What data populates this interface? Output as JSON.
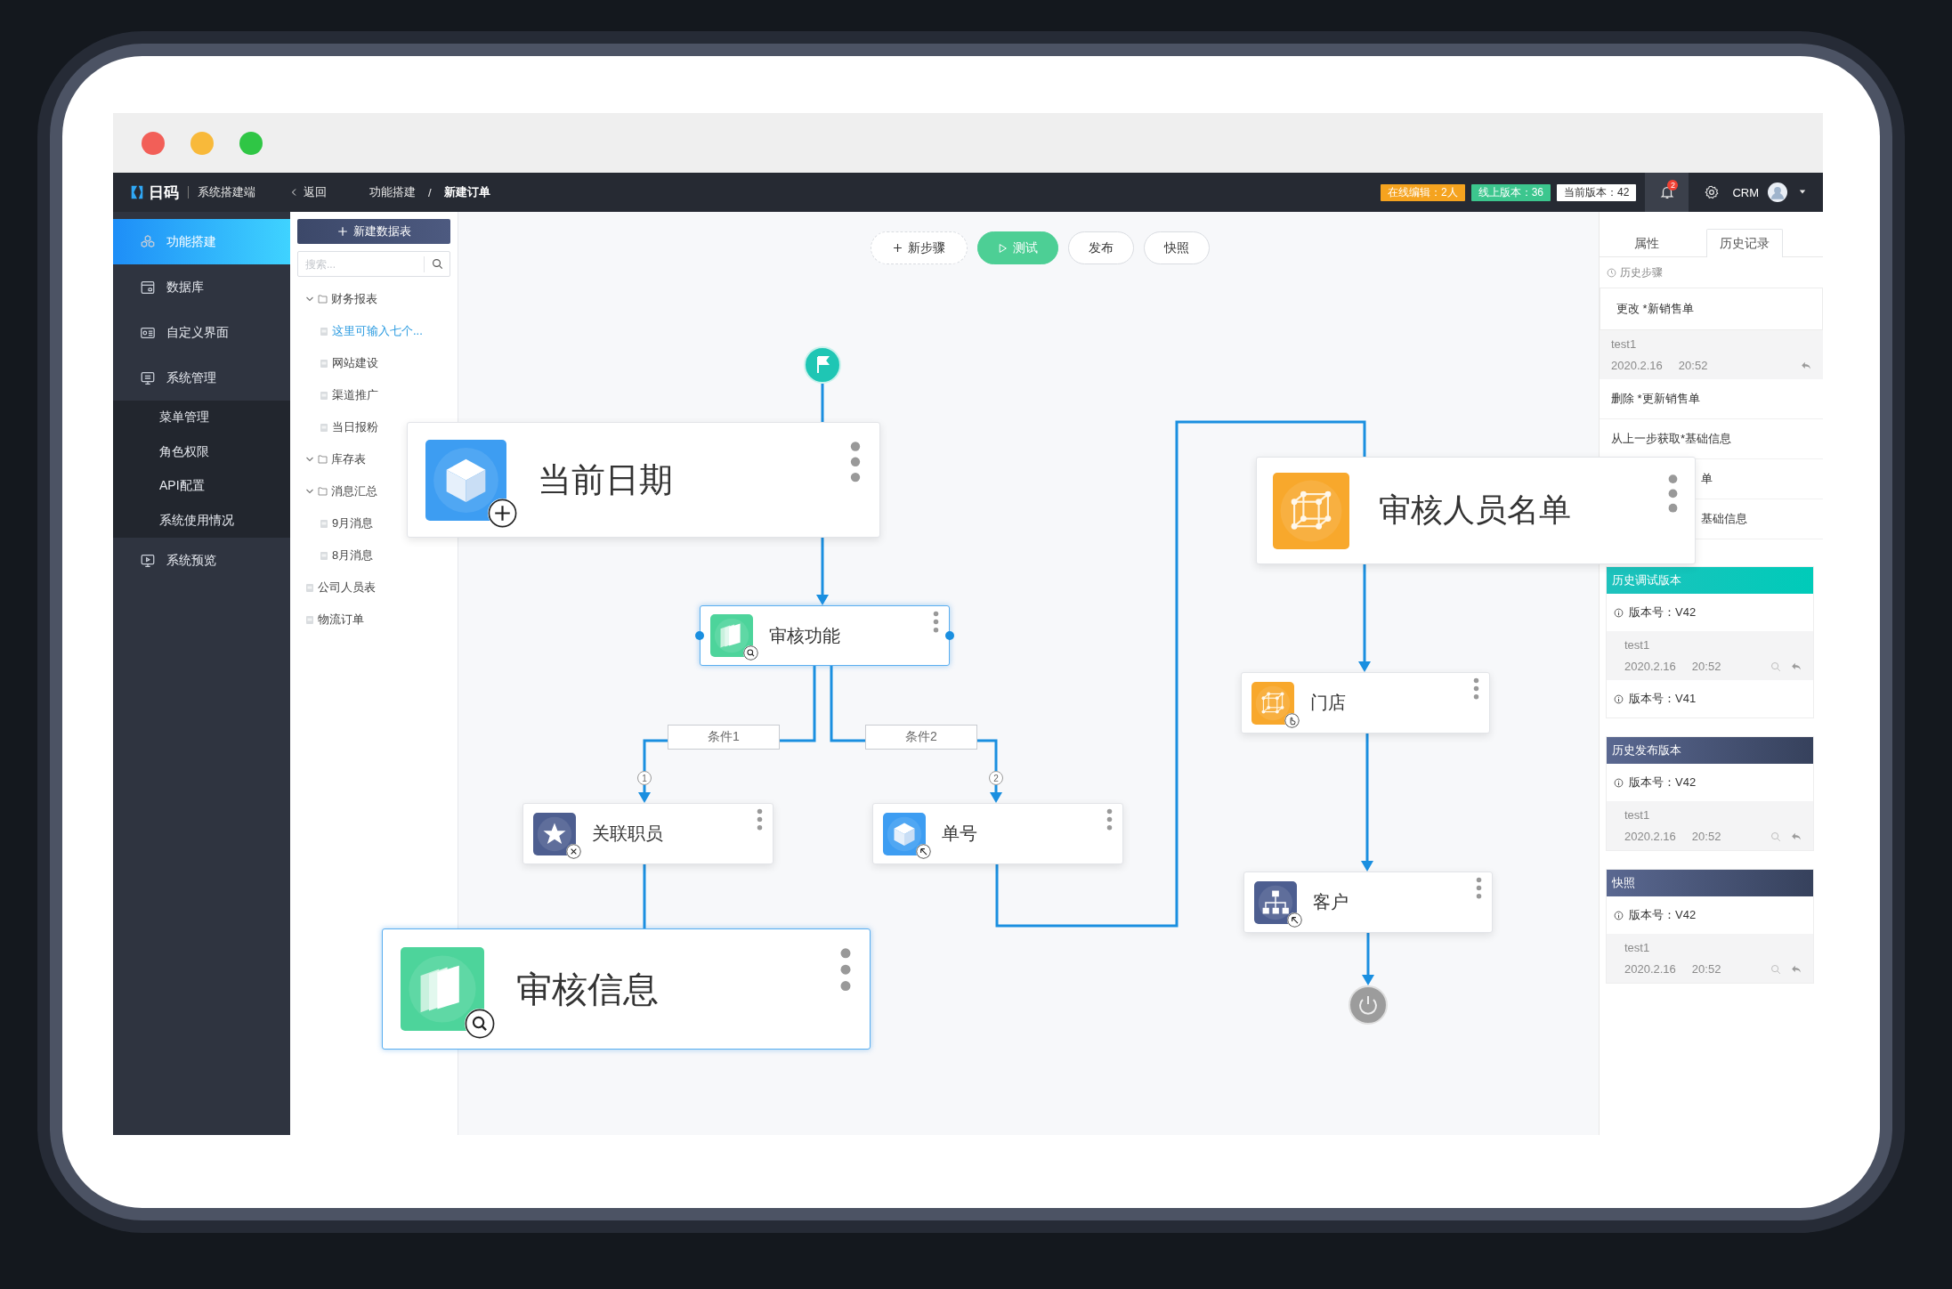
{
  "topbar": {
    "logo": "日码",
    "app_name": "系统搭建端",
    "back": "返回",
    "breadcrumb": [
      {
        "label": "功能搭建",
        "current": false
      },
      {
        "label": "新建订单",
        "current": true
      }
    ],
    "separator": "/",
    "badges": [
      {
        "text": "在线编辑：2人",
        "color": "#f5a31f"
      },
      {
        "text": "线上版本：36",
        "color": "#3cc68e"
      },
      {
        "text": "当前版本：42",
        "color": "#ffffff"
      }
    ],
    "notifications": "2",
    "user": "CRM"
  },
  "sidebar": {
    "items": [
      {
        "label": "功能搭建",
        "selected": true
      },
      {
        "label": "数据库",
        "selected": false
      },
      {
        "label": "自定义界面",
        "selected": false
      },
      {
        "label": "系统管理",
        "selected": false,
        "children": [
          {
            "label": "菜单管理",
            "selected": false
          },
          {
            "label": "角色权限",
            "selected": false
          },
          {
            "label": "API配置",
            "selected": false
          },
          {
            "label": "系统使用情况",
            "selected": false
          }
        ]
      },
      {
        "label": "系统预览",
        "selected": false
      }
    ]
  },
  "tree": {
    "new_button": "新建数据表",
    "search": {
      "placeholder": "搜索..."
    },
    "items": [
      {
        "label": "财务报表",
        "kind": "folder",
        "expanded": true,
        "selected": false,
        "children": [
          {
            "label": "这里可输入七个...",
            "kind": "file",
            "selected": true
          },
          {
            "label": "网站建设",
            "kind": "file",
            "selected": false
          },
          {
            "label": "渠道推广",
            "kind": "file",
            "selected": false
          },
          {
            "label": "当日报粉",
            "kind": "file",
            "selected": false
          }
        ]
      },
      {
        "label": "库存表",
        "kind": "folder",
        "expanded": true,
        "selected": false
      },
      {
        "label": "消息汇总",
        "kind": "folder",
        "expanded": true,
        "selected": false,
        "children": [
          {
            "label": "9月消息",
            "kind": "file",
            "selected": false
          },
          {
            "label": "8月消息",
            "kind": "file",
            "selected": false
          }
        ]
      },
      {
        "label": "公司人员表",
        "kind": "file",
        "selected": false
      },
      {
        "label": "物流订单",
        "kind": "file",
        "selected": false
      }
    ]
  },
  "canvas": {
    "toolbar": [
      {
        "label": "新步骤",
        "kind": "add"
      },
      {
        "label": "测试",
        "kind": "run"
      },
      {
        "label": "发布",
        "kind": "plain"
      },
      {
        "label": "快照",
        "kind": "plain"
      }
    ],
    "nodes": [
      {
        "title": "当前日期",
        "color": "#3d9df2",
        "highlighted": false
      },
      {
        "title": "审核功能",
        "color": "#4dd49b",
        "highlighted": true
      },
      {
        "title": "关联职员",
        "color": "#4d5e90",
        "highlighted": false
      },
      {
        "title": "单号",
        "color": "#3d9df2",
        "highlighted": false
      },
      {
        "title": "审核信息",
        "color": "#4dd49b",
        "highlighted": true
      },
      {
        "title": "审核人员名单",
        "color": "#f8a82c",
        "highlighted": false
      },
      {
        "title": "门店",
        "color": "#f8a82c",
        "highlighted": false
      },
      {
        "title": "客户",
        "color": "#4d5e90",
        "highlighted": false
      }
    ],
    "branches": [
      {
        "label": "条件1",
        "number": "1"
      },
      {
        "label": "条件2",
        "number": "2"
      }
    ]
  },
  "panel": {
    "tabs": [
      {
        "label": "属性",
        "selected": false
      },
      {
        "label": "历史记录",
        "selected": true
      }
    ],
    "steps_title": "历史步骤",
    "steps": [
      {
        "kind": "change",
        "text": "更改 *新销售单"
      },
      {
        "kind": "record",
        "user": "test1",
        "date": "2020.2.16",
        "time": "20:52"
      },
      {
        "kind": "action",
        "text": "删除 *更新销售单"
      },
      {
        "kind": "action",
        "text": "从上一步获取*基础信息"
      },
      {
        "kind": "covered",
        "text": "单"
      },
      {
        "kind": "covered",
        "text": "基础信息"
      }
    ],
    "sections": [
      {
        "title": "历史调试版本",
        "kind": "debug",
        "entries": [
          {
            "kind": "version",
            "text": "版本号：V42"
          },
          {
            "kind": "record",
            "user": "test1",
            "date": "2020.2.16",
            "time": "20:52"
          },
          {
            "kind": "version",
            "text": "版本号：V41"
          }
        ]
      },
      {
        "title": "历史发布版本",
        "kind": "release",
        "entries": [
          {
            "kind": "version",
            "text": "版本号：V42"
          },
          {
            "kind": "record",
            "user": "test1",
            "date": "2020.2.16",
            "time": "20:52"
          }
        ]
      },
      {
        "title": "快照",
        "kind": "snapshot",
        "entries": [
          {
            "kind": "version",
            "text": "版本号：V42"
          },
          {
            "kind": "record",
            "user": "test1",
            "date": "2020.2.16",
            "time": "20:52"
          }
        ]
      }
    ]
  }
}
